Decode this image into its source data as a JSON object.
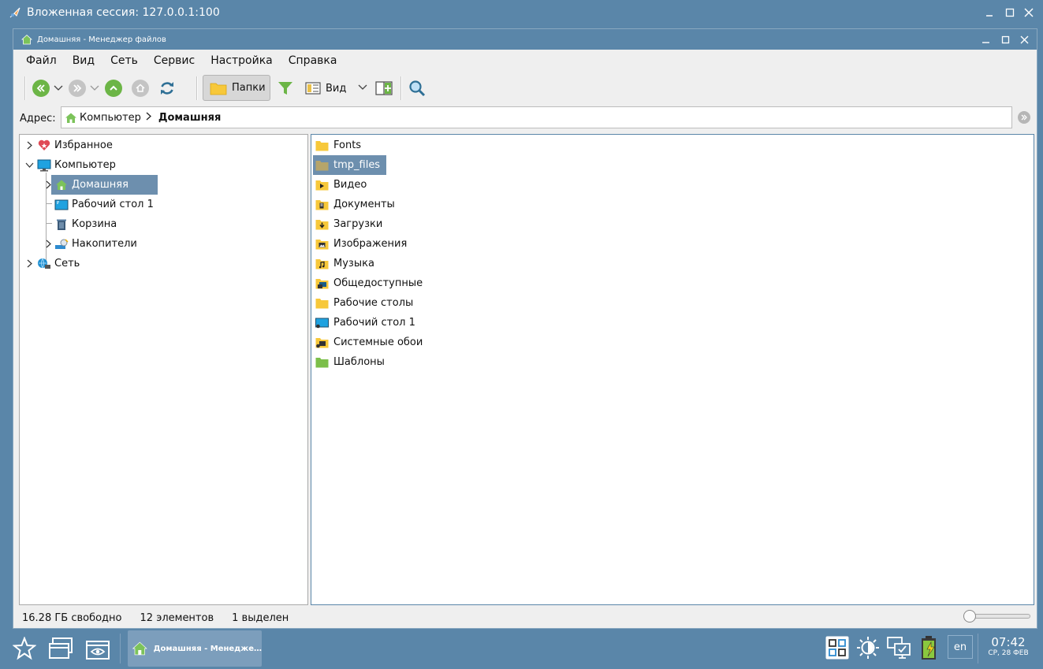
{
  "outer_window": {
    "title": "Вложенная сессия: 127.0.0.1:100"
  },
  "window": {
    "title": "Домашняя - Менеджер файлов"
  },
  "menu": [
    "Файл",
    "Вид",
    "Сеть",
    "Сервис",
    "Настройка",
    "Справка"
  ],
  "toolbar": {
    "folders_label": "Папки",
    "view_label": "Вид"
  },
  "address": {
    "label": "Адрес:",
    "crumbs": [
      "Компьютер",
      "Домашняя"
    ]
  },
  "tree": {
    "items": [
      {
        "label": "Избранное",
        "icon": "heart-icon"
      },
      {
        "label": "Компьютер",
        "icon": "monitor-icon"
      },
      {
        "label": "Домашняя",
        "icon": "home-icon",
        "selected": true
      },
      {
        "label": "Рабочий стол 1",
        "icon": "desktop-icon"
      },
      {
        "label": "Корзина",
        "icon": "trash-icon"
      },
      {
        "label": "Накопители",
        "icon": "drives-icon"
      },
      {
        "label": "Сеть",
        "icon": "network-icon"
      }
    ]
  },
  "files": [
    {
      "name": "Fonts",
      "icon": "folder-icon"
    },
    {
      "name": "tmp_files",
      "icon": "folder-icon",
      "selected": true
    },
    {
      "name": "Видео",
      "icon": "folder-video-icon"
    },
    {
      "name": "Документы",
      "icon": "folder-documents-icon"
    },
    {
      "name": "Загрузки",
      "icon": "folder-downloads-icon"
    },
    {
      "name": "Изображения",
      "icon": "folder-pictures-icon"
    },
    {
      "name": "Музыка",
      "icon": "folder-music-icon"
    },
    {
      "name": "Общедоступные",
      "icon": "folder-public-icon"
    },
    {
      "name": "Рабочие столы",
      "icon": "folder-icon"
    },
    {
      "name": "Рабочий стол 1",
      "icon": "desktop-icon"
    },
    {
      "name": "Системные обои",
      "icon": "folder-wallpapers-icon"
    },
    {
      "name": "Шаблоны",
      "icon": "folder-templates-icon"
    }
  ],
  "status": {
    "free": "16.28 ГБ свободно",
    "count": "12 элементов",
    "selected": "1 выделен",
    "zoom": 0
  },
  "taskbar": {
    "task_label": "Домашняя - Менедже…",
    "lang": "en",
    "time": "07:42",
    "date": "СР, 28 ФЕВ"
  },
  "colors": {
    "accent": "#5a86a9",
    "selection": "#6d8fae",
    "folder": "#f7c83a"
  }
}
